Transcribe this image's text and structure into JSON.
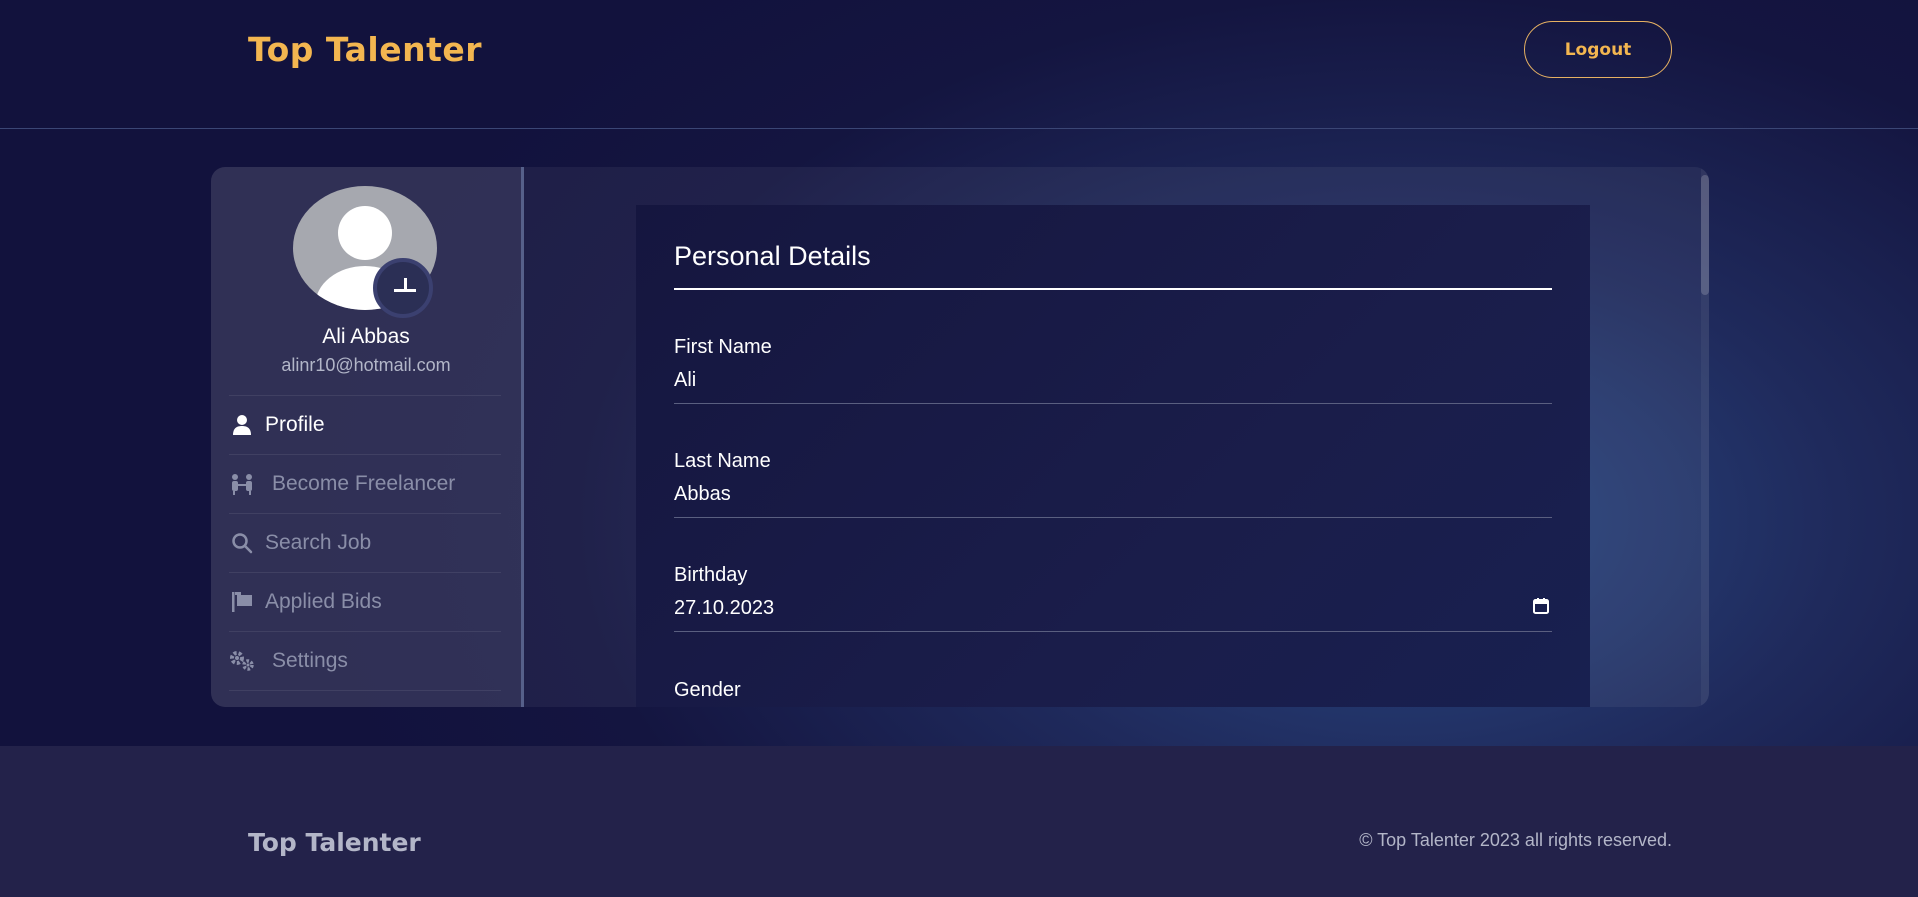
{
  "header": {
    "brand": "Top Talenter",
    "logout_label": "Logout"
  },
  "sidebar": {
    "user_name": "Ali Abbas",
    "user_email": "alinr10@hotmail.com",
    "items": [
      {
        "label": "Profile",
        "icon": "user-icon",
        "active": true
      },
      {
        "label": "Become Freelancer",
        "icon": "people-icon",
        "active": false
      },
      {
        "label": "Search Job",
        "icon": "search-icon",
        "active": false
      },
      {
        "label": "Applied Bids",
        "icon": "flag-icon",
        "active": false
      },
      {
        "label": "Settings",
        "icon": "gears-icon",
        "active": false
      }
    ]
  },
  "form": {
    "title": "Personal Details",
    "fields": [
      {
        "label": "First Name",
        "value": "Ali"
      },
      {
        "label": "Last Name",
        "value": "Abbas"
      },
      {
        "label": "Birthday",
        "value": "27.10.2023"
      },
      {
        "label": "Gender",
        "value": ""
      }
    ]
  },
  "footer": {
    "brand": "Top Talenter",
    "copyright": "© Top Talenter 2023 all rights reserved."
  },
  "colors": {
    "accent": "#f3b650",
    "background": "#141540",
    "footer_bg": "#23224a"
  }
}
